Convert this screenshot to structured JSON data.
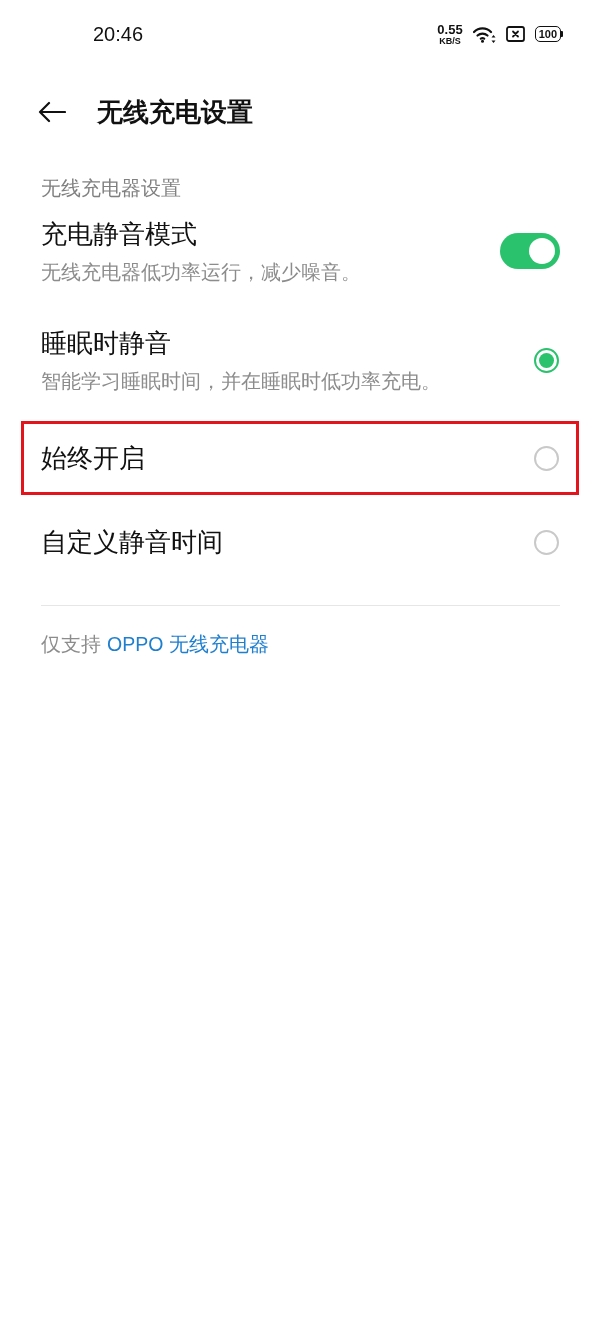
{
  "status_bar": {
    "time": "20:46",
    "net_speed": "0.55",
    "net_unit": "KB/S",
    "battery": "100"
  },
  "header": {
    "title": "无线充电设置"
  },
  "section_title": "无线充电器设置",
  "toggle": {
    "title": "充电静音模式",
    "subtitle": "无线充电器低功率运行，减少噪音。",
    "on": true
  },
  "modes": [
    {
      "title": "睡眠时静音",
      "subtitle": "智能学习睡眠时间，并在睡眠时低功率充电。",
      "selected": true,
      "highlighted": false
    },
    {
      "title": "始终开启",
      "selected": false,
      "highlighted": true
    },
    {
      "title": "自定义静音时间",
      "selected": false,
      "highlighted": false
    }
  ],
  "footer": {
    "text": "仅支持",
    "link": "OPPO 无线充电器"
  }
}
